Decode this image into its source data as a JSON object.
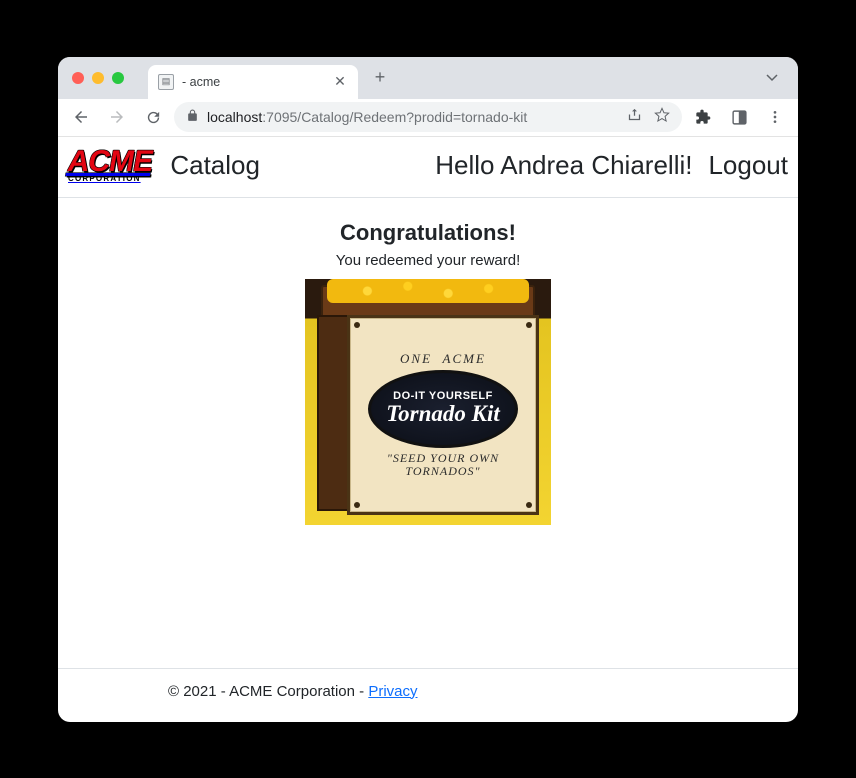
{
  "browser": {
    "tab_title": "- acme",
    "url_host": "localhost",
    "url_port_path": ":7095/Catalog/Redeem?prodid=tornado-kit"
  },
  "navbar": {
    "logo_main": "ACME",
    "logo_sub": "CORPORATION",
    "catalog": "Catalog",
    "greeting": "Hello Andrea Chiarelli!",
    "logout": "Logout"
  },
  "main": {
    "heading": "Congratulations!",
    "subtext": "You redeemed your reward!",
    "product": {
      "pre1": "ONE",
      "pre2": "ACME",
      "line1": "DO-IT YOURSELF",
      "line2": "Tornado Kit",
      "post1": "\"SEED YOUR OWN",
      "post2": "TORNADOS\""
    }
  },
  "footer": {
    "copyright": "© 2021 - ACME Corporation - ",
    "privacy": "Privacy"
  }
}
